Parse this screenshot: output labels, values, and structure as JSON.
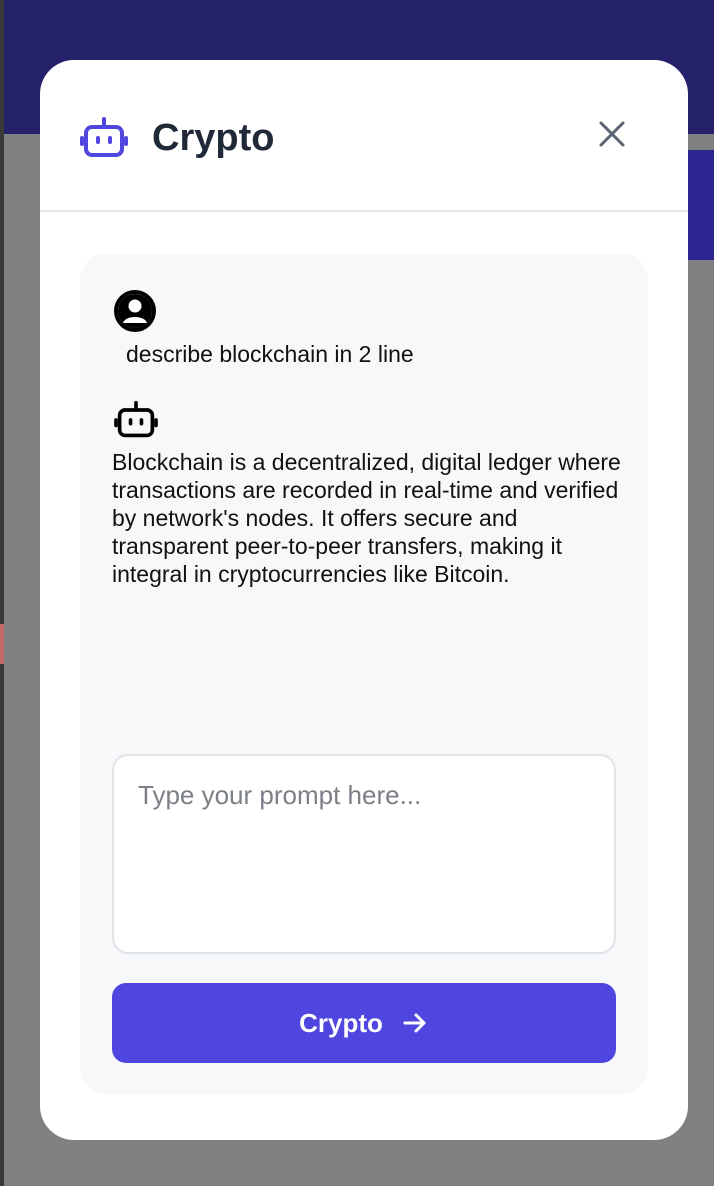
{
  "modal": {
    "title": "Crypto",
    "close_icon": "close-icon",
    "header_icon": "robot-icon"
  },
  "chat": {
    "messages": [
      {
        "role": "user",
        "icon": "user-avatar-icon",
        "text": " describe blockchain in 2 line"
      },
      {
        "role": "assistant",
        "icon": "robot-icon",
        "text": " Blockchain is a decentralized, digital ledger where transactions are recorded in real-time and verified by network's nodes. It offers secure and transparent peer-to-peer transfers, making it integral in cryptocurrencies like Bitcoin."
      }
    ]
  },
  "prompt": {
    "placeholder": "Type your prompt here...",
    "value": ""
  },
  "submit": {
    "label": "Crypto",
    "icon": "arrow-right-icon"
  },
  "colors": {
    "accent": "#4f46e0",
    "backdrop_header": "#25216b",
    "panel_bg": "#f7f8fa",
    "title_text": "#1f2937"
  }
}
